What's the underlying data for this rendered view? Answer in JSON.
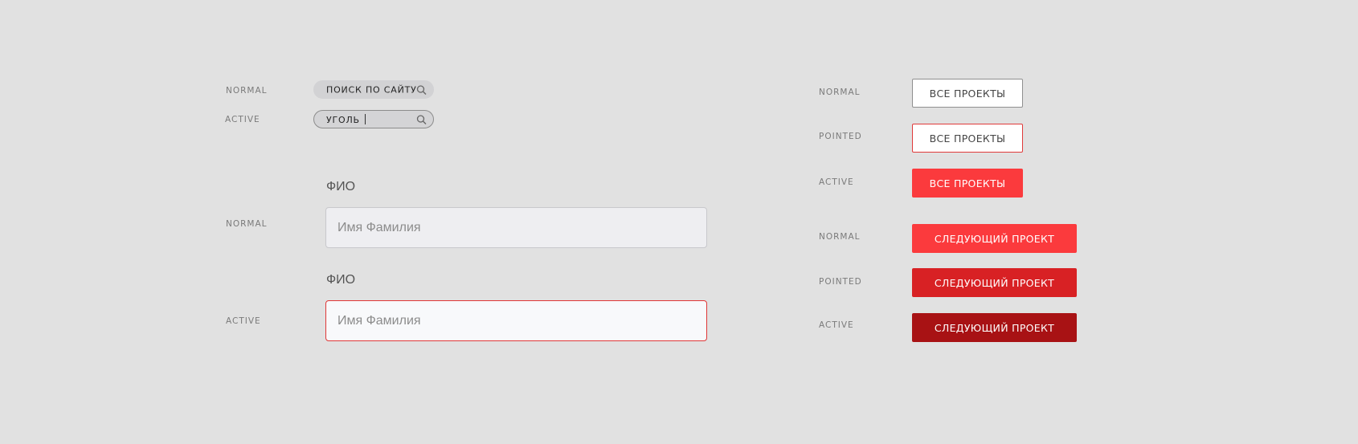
{
  "colors": {
    "background": "#e1e1e1",
    "accent_red": "#fb3a3d",
    "pointed_red": "#d82124",
    "active_red": "#a81214",
    "outline_red": "#e03a3a"
  },
  "search": {
    "normal_state": "NORMAL",
    "active_state": "ACTIVE",
    "placeholder": "ПОИСК ПО САЙТУ",
    "active_value": "УГОЛЬ",
    "icon": "search-icon"
  },
  "form": {
    "normal_state": "NORMAL",
    "active_state": "ACTIVE",
    "normal_label": "ФИО",
    "active_label": "ФИО",
    "placeholder": "Имя Фамилия"
  },
  "buttons_secondary": {
    "label": "ВСЕ ПРОЕКТЫ",
    "states": [
      "NORMAL",
      "POINTED",
      "ACTIVE"
    ]
  },
  "buttons_primary": {
    "label": "СЛЕДУЮЩИЙ ПРОЕКТ",
    "states": [
      "NORMAL",
      "POINTED",
      "ACTIVE"
    ]
  }
}
